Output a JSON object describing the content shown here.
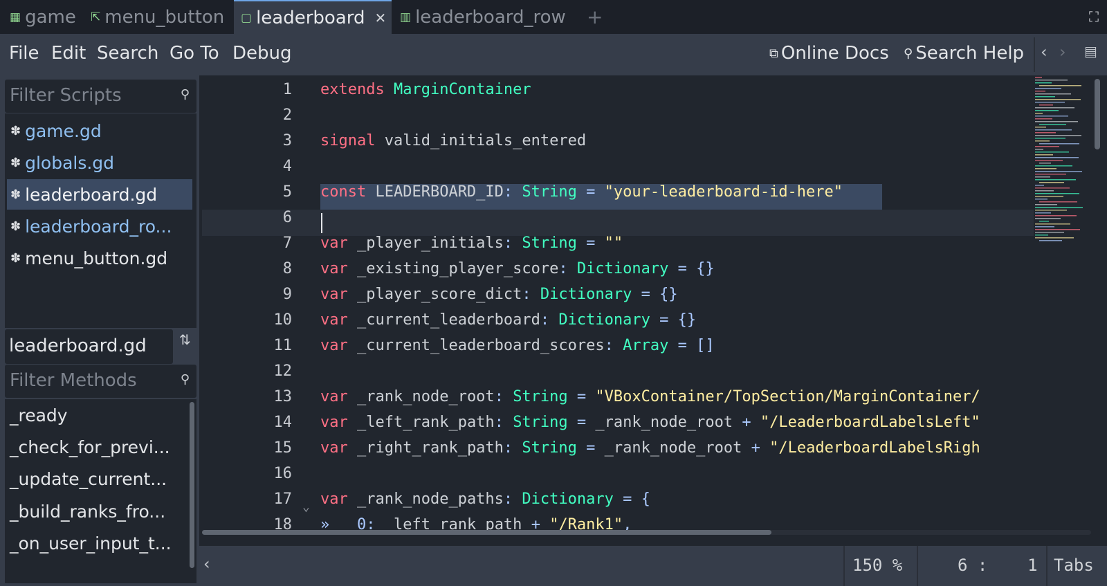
{
  "tabs": [
    {
      "label": "game",
      "icon": "scene-grid-icon"
    },
    {
      "label": "menu_button",
      "icon": "scene-button-icon"
    },
    {
      "label": "leaderboard",
      "icon": "scene-container-icon",
      "active": true
    },
    {
      "label": "leaderboard_row",
      "icon": "scene-row-icon"
    }
  ],
  "tab_close": "✕",
  "tab_add": "+",
  "menu": {
    "file": "File",
    "edit": "Edit",
    "search": "Search",
    "goto": "Go To",
    "debug": "Debug",
    "online_docs": "Online Docs",
    "search_help": "Search Help"
  },
  "scripts": {
    "filter_placeholder": "Filter Scripts",
    "items": [
      {
        "label": "game.gd"
      },
      {
        "label": "globals.gd"
      },
      {
        "label": "leaderboard.gd",
        "active": true
      },
      {
        "label": "leaderboard_ro..."
      },
      {
        "label": "menu_button.gd"
      }
    ]
  },
  "current_file": "leaderboard.gd",
  "methods": {
    "filter_placeholder": "Filter Methods",
    "items": [
      "_ready",
      "_check_for_previ...",
      "_update_current...",
      "_build_ranks_fro...",
      "_on_user_input_t..."
    ]
  },
  "code_lines": [
    {
      "n": "1",
      "html": "<span class=\"kw\">extends</span> <span class=\"ty\">MarginContainer</span>"
    },
    {
      "n": "2",
      "html": ""
    },
    {
      "n": "3",
      "html": "<span class=\"kw\">signal</span> <span class=\"id\">valid_initials_entered</span>"
    },
    {
      "n": "4",
      "html": ""
    },
    {
      "n": "5",
      "html": "<span class=\"kw\">const</span> <span class=\"id\">LEADERBOARD_ID</span><span class=\"op\">:</span> <span class=\"ty\">String</span> <span class=\"op\">=</span> <span class=\"str\">\"your-leaderboard-id-here\"</span>"
    },
    {
      "n": "6",
      "html": ""
    },
    {
      "n": "7",
      "html": "<span class=\"kw\">var</span> <span class=\"id\">_player_initials</span><span class=\"op\">:</span> <span class=\"ty\">String</span> <span class=\"op\">=</span> <span class=\"str\">\"\"</span>"
    },
    {
      "n": "8",
      "html": "<span class=\"kw\">var</span> <span class=\"id\">_existing_player_score</span><span class=\"op\">:</span> <span class=\"ty\">Dictionary</span> <span class=\"op\">=</span> <span class=\"op\">{}</span>"
    },
    {
      "n": "9",
      "html": "<span class=\"kw\">var</span> <span class=\"id\">_player_score_dict</span><span class=\"op\">:</span> <span class=\"ty\">Dictionary</span> <span class=\"op\">=</span> <span class=\"op\">{}</span>"
    },
    {
      "n": "10",
      "html": "<span class=\"kw\">var</span> <span class=\"id\">_current_leaderboard</span><span class=\"op\">:</span> <span class=\"ty\">Dictionary</span> <span class=\"op\">=</span> <span class=\"op\">{}</span>"
    },
    {
      "n": "11",
      "html": "<span class=\"kw\">var</span> <span class=\"id\">_current_leaderboard_scores</span><span class=\"op\">:</span> <span class=\"ty\">Array</span> <span class=\"op\">=</span> <span class=\"op\">[]</span>"
    },
    {
      "n": "12",
      "html": ""
    },
    {
      "n": "13",
      "html": "<span class=\"kw\">var</span> <span class=\"id\">_rank_node_root</span><span class=\"op\">:</span> <span class=\"ty\">String</span> <span class=\"op\">=</span> <span class=\"str\">\"VBoxContainer/TopSection/MarginContainer/</span>"
    },
    {
      "n": "14",
      "html": "<span class=\"kw\">var</span> <span class=\"id\">_left_rank_path</span><span class=\"op\">:</span> <span class=\"ty\">String</span> <span class=\"op\">=</span> <span class=\"id\">_rank_node_root</span> <span class=\"op\">+</span> <span class=\"str\">\"/LeaderboardLabelsLeft\"</span>"
    },
    {
      "n": "15",
      "html": "<span class=\"kw\">var</span> <span class=\"id\">_right_rank_path</span><span class=\"op\">:</span> <span class=\"ty\">String</span> <span class=\"op\">=</span> <span class=\"id\">_rank_node_root</span> <span class=\"op\">+</span> <span class=\"str\">\"/LeaderboardLabelsRigh</span>"
    },
    {
      "n": "16",
      "html": ""
    },
    {
      "n": "17",
      "html": "<span class=\"kw\">var</span> <span class=\"id\">_rank_node_paths</span><span class=\"op\">:</span> <span class=\"ty\">Dictionary</span> <span class=\"op\">=</span> <span class=\"op\">{</span>"
    },
    {
      "n": "18",
      "html": "<span class=\"op\">»</span>   <span class=\"op\">0</span><span class=\"op\">:</span> <span class=\"id\">_left_rank_path</span> <span class=\"op\">+</span> <span class=\"str\">\"/Rank1\"</span><span class=\"op\">,</span>"
    }
  ],
  "status": {
    "toggle": "‹",
    "zoom": "150 %",
    "line": "6",
    "col": "1",
    "cursor": "6 :    1",
    "indent": "Tabs"
  }
}
